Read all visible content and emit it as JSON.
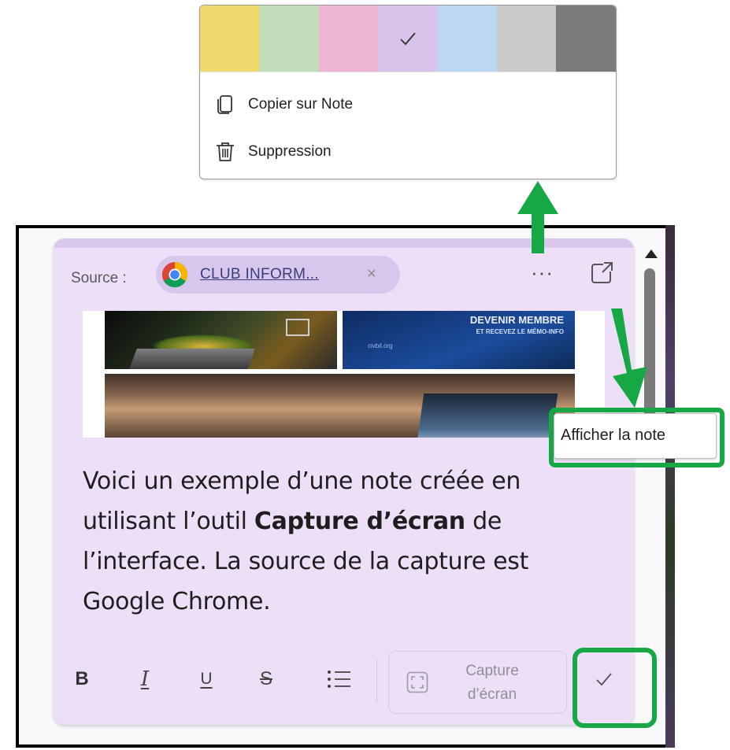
{
  "colors": {
    "accent_green": "#15a845",
    "note_background": "#eddff7"
  },
  "menu": {
    "swatches": [
      {
        "name": "yellow",
        "color": "#f2d96b",
        "selected": false
      },
      {
        "name": "green",
        "color": "#c1ddb9",
        "selected": false
      },
      {
        "name": "pink",
        "color": "#efb6d3",
        "selected": false
      },
      {
        "name": "purple",
        "color": "#d8c3ea",
        "selected": true
      },
      {
        "name": "blue",
        "color": "#bdd7f2",
        "selected": false
      },
      {
        "name": "light-gray",
        "color": "#c9c9c9",
        "selected": false
      },
      {
        "name": "dark-gray",
        "color": "#7b7b7b",
        "selected": false
      }
    ],
    "copy_label": "Copier sur Note",
    "delete_label": "Suppression"
  },
  "note": {
    "source_label": "Source :",
    "source_chip_text": "CLUB INFORM...",
    "source_chip_close": "×",
    "more_label": "···",
    "screenshot": {
      "banner_title": "DEVENIR MEMBRE",
      "banner_subtitle": "ET RECEVEZ LE MÉMO-INFO",
      "banner_site": "civbil.org"
    },
    "body": {
      "line1": "Voici un exemple d’une note créée en",
      "line2_before": "utilisant l’outil ",
      "line2_bold": "Capture d’écran",
      "line2_after": " de",
      "line3": "l’interface.  La source de la capture est",
      "line4": "Google Chrome."
    },
    "toolbar": {
      "bold": "B",
      "italic": "I",
      "underline": "U",
      "strikethrough": "S",
      "capture_line1": "Capture",
      "capture_line2": "d’écran"
    }
  },
  "tooltip": {
    "text": "Afficher la note"
  }
}
